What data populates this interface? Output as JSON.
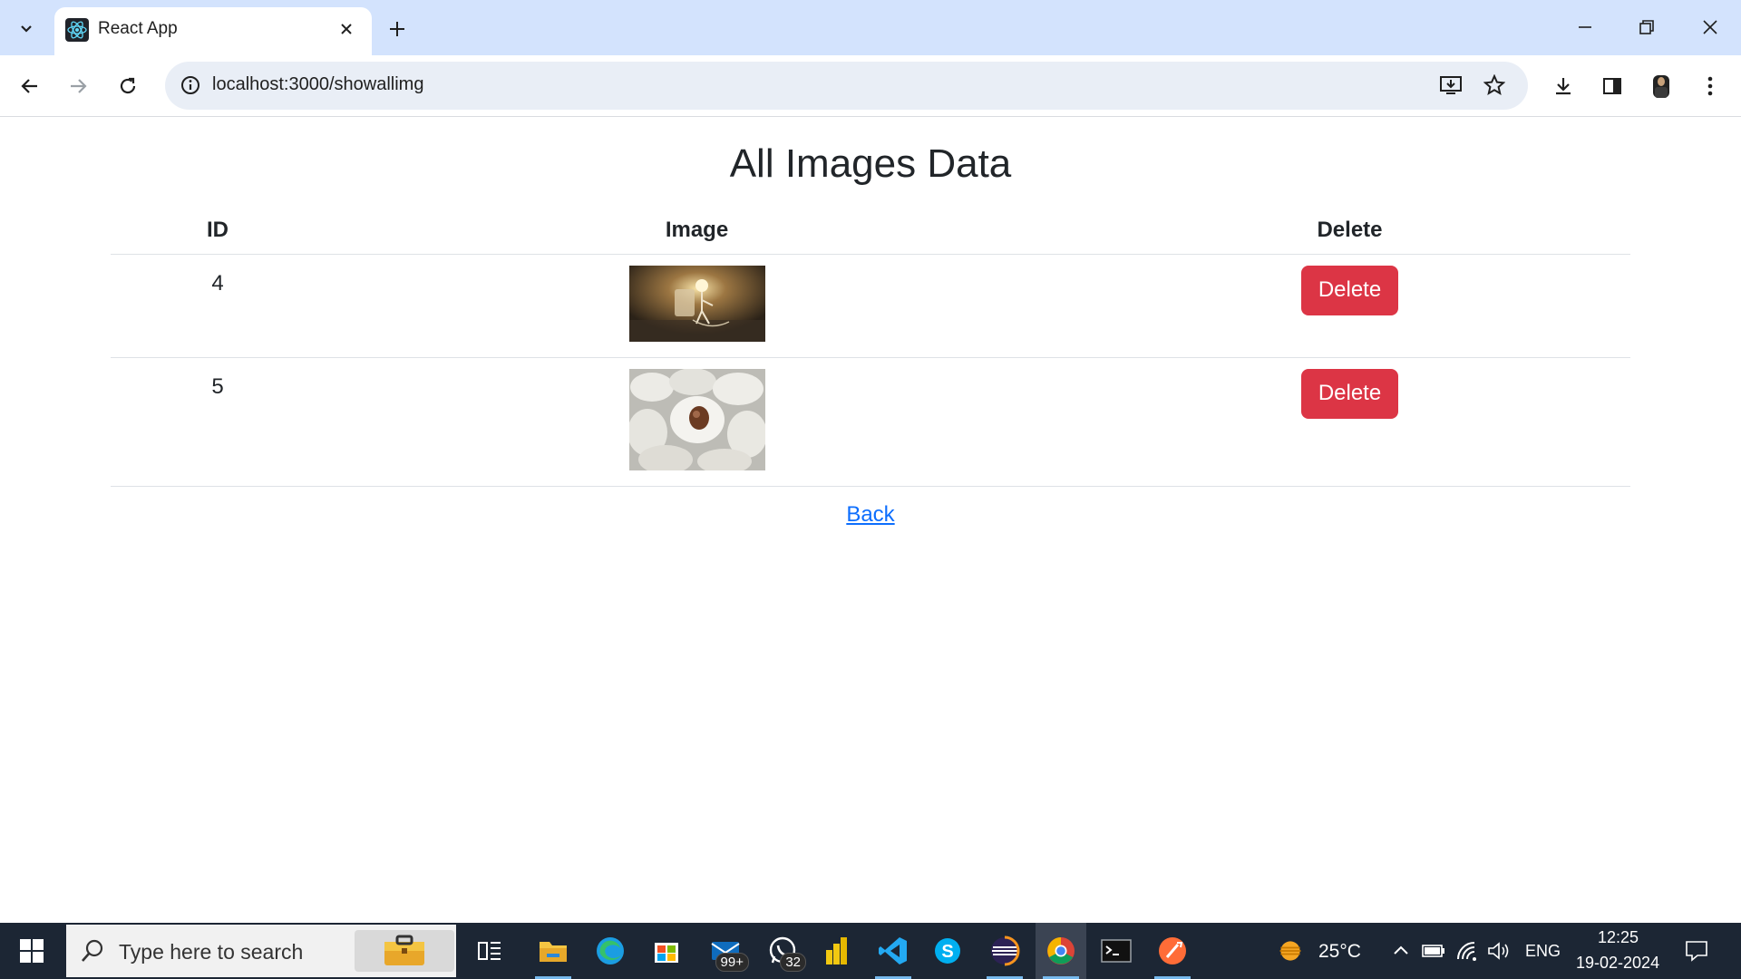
{
  "browser": {
    "tab": {
      "title": "React App"
    },
    "address_bar": {
      "url": "localhost:3000/showallimg"
    }
  },
  "page": {
    "title": "All Images Data",
    "table": {
      "headers": {
        "id": "ID",
        "image": "Image",
        "delete": "Delete"
      },
      "rows": [
        {
          "id": "4",
          "image_icon": "lightbulb-photo",
          "delete_label": "Delete"
        },
        {
          "id": "5",
          "image_icon": "silk-cocoons-photo",
          "delete_label": "Delete"
        }
      ]
    },
    "back_link": "Back",
    "colors": {
      "delete_button": "#dc3545",
      "link": "#0d6efd"
    }
  },
  "taskbar": {
    "search_placeholder": "Type here to search",
    "mail_badge": "99+",
    "whatsapp_badge": "32",
    "weather": "25°C",
    "language": "ENG",
    "time": "12:25",
    "date": "19-02-2024"
  }
}
